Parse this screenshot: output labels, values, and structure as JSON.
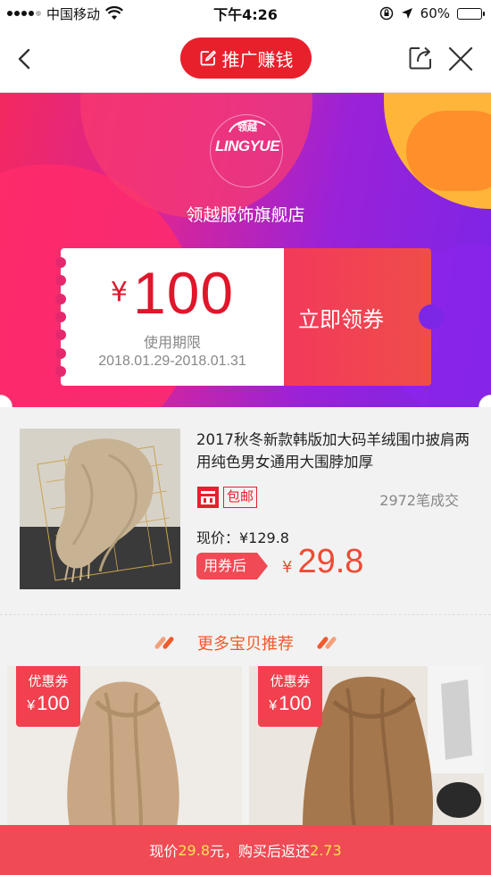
{
  "status_bar": {
    "carrier": "中国移动",
    "time": "下午4:26",
    "battery": "60%",
    "battery_level": 0.6
  },
  "nav": {
    "title": "推广赚钱",
    "icons": [
      "back-icon",
      "share-icon",
      "close-icon"
    ]
  },
  "banner": {
    "logo_text": "LINGYUE",
    "logo_cn": "领越",
    "shop_name": "领越服饰旗舰店"
  },
  "coupon": {
    "currency": "¥",
    "amount": "100",
    "validity_label": "使用期限",
    "dates": "2018.01.29-2018.01.31",
    "claim_label": "立即领券"
  },
  "product": {
    "title": "2017秋冬新款韩版加大码羊绒围巾披肩两用纯色男女通用大围脖加厚",
    "free_shipping": "包邮",
    "sold": "2972笔成交",
    "price_label": "现价：¥129.8",
    "after_coupon_label": "用券后",
    "after_coupon_currency": "¥",
    "after_coupon_price": "29.8"
  },
  "recommend": {
    "title": "更多宝贝推荐",
    "items": [
      {
        "badge_label": "优惠券",
        "currency": "¥",
        "amount": "100"
      },
      {
        "badge_label": "优惠券",
        "currency": "¥",
        "amount": "100"
      }
    ]
  },
  "bottom_bar": {
    "prefix": "现价",
    "price": "29.8",
    "middle": "元，购买后返还",
    "rebate": "2.73"
  },
  "colors": {
    "brand_red": "#e8202c",
    "coupon_red": "#f04a55",
    "price_orange": "#f04a33",
    "highlight_yellow": "#ffe14d",
    "banner_pink": "#f3285f",
    "banner_purple": "#7a25e8"
  }
}
